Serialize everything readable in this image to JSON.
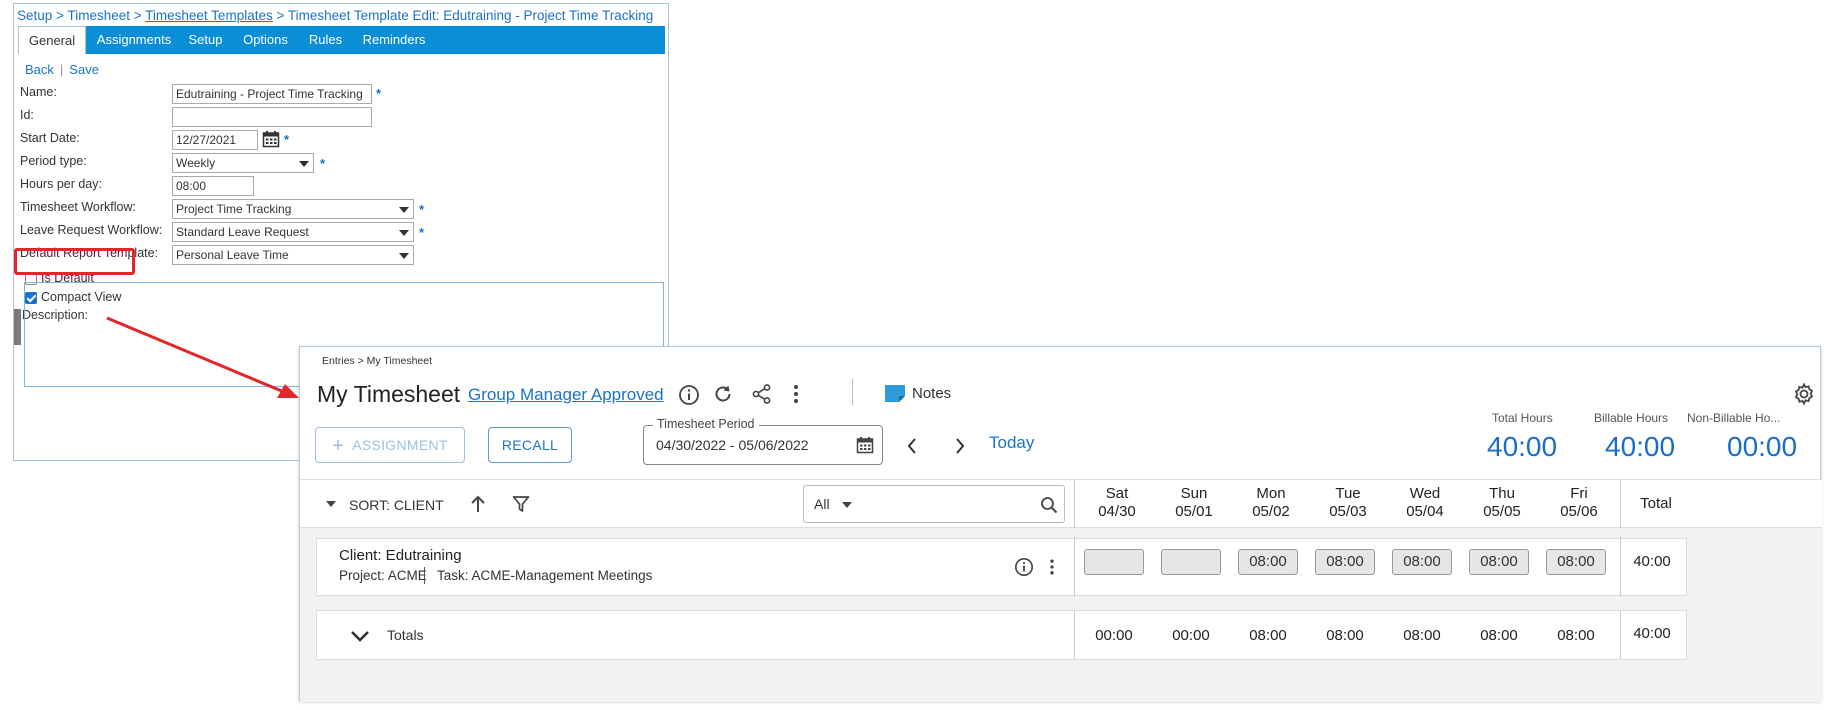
{
  "setup": {
    "breadcrumb": {
      "setup": "Setup",
      "timesheet": "Timesheet",
      "templates": "Timesheet Templates",
      "current": "Timesheet Template Edit: Edutraining - Project Time Tracking",
      "separator": ">"
    },
    "tabs": [
      "General",
      "Assignments",
      "Setup",
      "Options",
      "Rules",
      "Reminders"
    ],
    "active_tab": "General",
    "actions": {
      "back": "Back",
      "save": "Save",
      "separator": "|"
    },
    "form": {
      "name_label": "Name:",
      "name_value": "Edutraining - Project Time Tracking",
      "id_label": "Id:",
      "id_value": "",
      "start_date_label": "Start Date:",
      "start_date_value": "12/27/2021",
      "period_type_label": "Period type:",
      "period_type_value": "Weekly",
      "hours_per_day_label": "Hours per day:",
      "hours_per_day_value": "08:00",
      "workflow_label": "Timesheet Workflow:",
      "workflow_value": "Project Time Tracking",
      "leave_workflow_label": "Leave Request Workflow:",
      "leave_workflow_value": "Standard Leave Request",
      "report_template_label": "Default Report Template:",
      "report_template_value": "Personal Leave Time",
      "is_default_label": "Is Default",
      "is_default_checked": false,
      "compact_view_label": "Compact View",
      "compact_view_checked": true,
      "description_label": "Description:",
      "required_mark": "*"
    }
  },
  "timesheet": {
    "breadcrumb": "Entries > My Timesheet",
    "title": "My Timesheet",
    "status": "Group Manager Approved",
    "notes_label": "Notes",
    "assignment_button": "ASSIGNMENT",
    "recall_button": "RECALL",
    "period_label": "Timesheet Period",
    "period_value": "04/30/2022 - 05/06/2022",
    "today_link": "Today",
    "summary": [
      {
        "label": "Total Hours",
        "value": "40:00"
      },
      {
        "label": "Billable Hours",
        "value": "40:00"
      },
      {
        "label": "Non-Billable Ho...",
        "value": "00:00"
      }
    ],
    "sort_label": "SORT: CLIENT",
    "filter_value": "All",
    "days": [
      {
        "day": "Sat",
        "date": "04/30"
      },
      {
        "day": "Sun",
        "date": "05/01"
      },
      {
        "day": "Mon",
        "date": "05/02"
      },
      {
        "day": "Tue",
        "date": "05/03"
      },
      {
        "day": "Wed",
        "date": "05/04"
      },
      {
        "day": "Thu",
        "date": "05/05"
      },
      {
        "day": "Fri",
        "date": "05/06"
      }
    ],
    "total_header": "Total",
    "entry": {
      "client": "Client: Edutraining",
      "project": "Project: ACME",
      "task": "Task: ACME-Management Meetings",
      "hours": [
        "",
        "",
        "08:00",
        "08:00",
        "08:00",
        "08:00",
        "08:00"
      ],
      "total": "40:00"
    },
    "totals_row": {
      "label": "Totals",
      "values": [
        "00:00",
        "00:00",
        "08:00",
        "08:00",
        "08:00",
        "08:00",
        "08:00"
      ],
      "total": "40:00"
    }
  },
  "colors": {
    "accent": "#1a73c9",
    "tab_bar": "#0a8fd6",
    "highlight": "#e3262a"
  },
  "icons": [
    "calendar-icon",
    "info-icon",
    "refresh-icon",
    "share-icon",
    "more-vertical-icon",
    "notes-icon",
    "gear-icon",
    "plus-icon",
    "chevron-left-icon",
    "chevron-right-icon",
    "caret-down-icon",
    "arrow-up-icon",
    "filter-icon",
    "search-icon",
    "chevron-down-icon"
  ]
}
